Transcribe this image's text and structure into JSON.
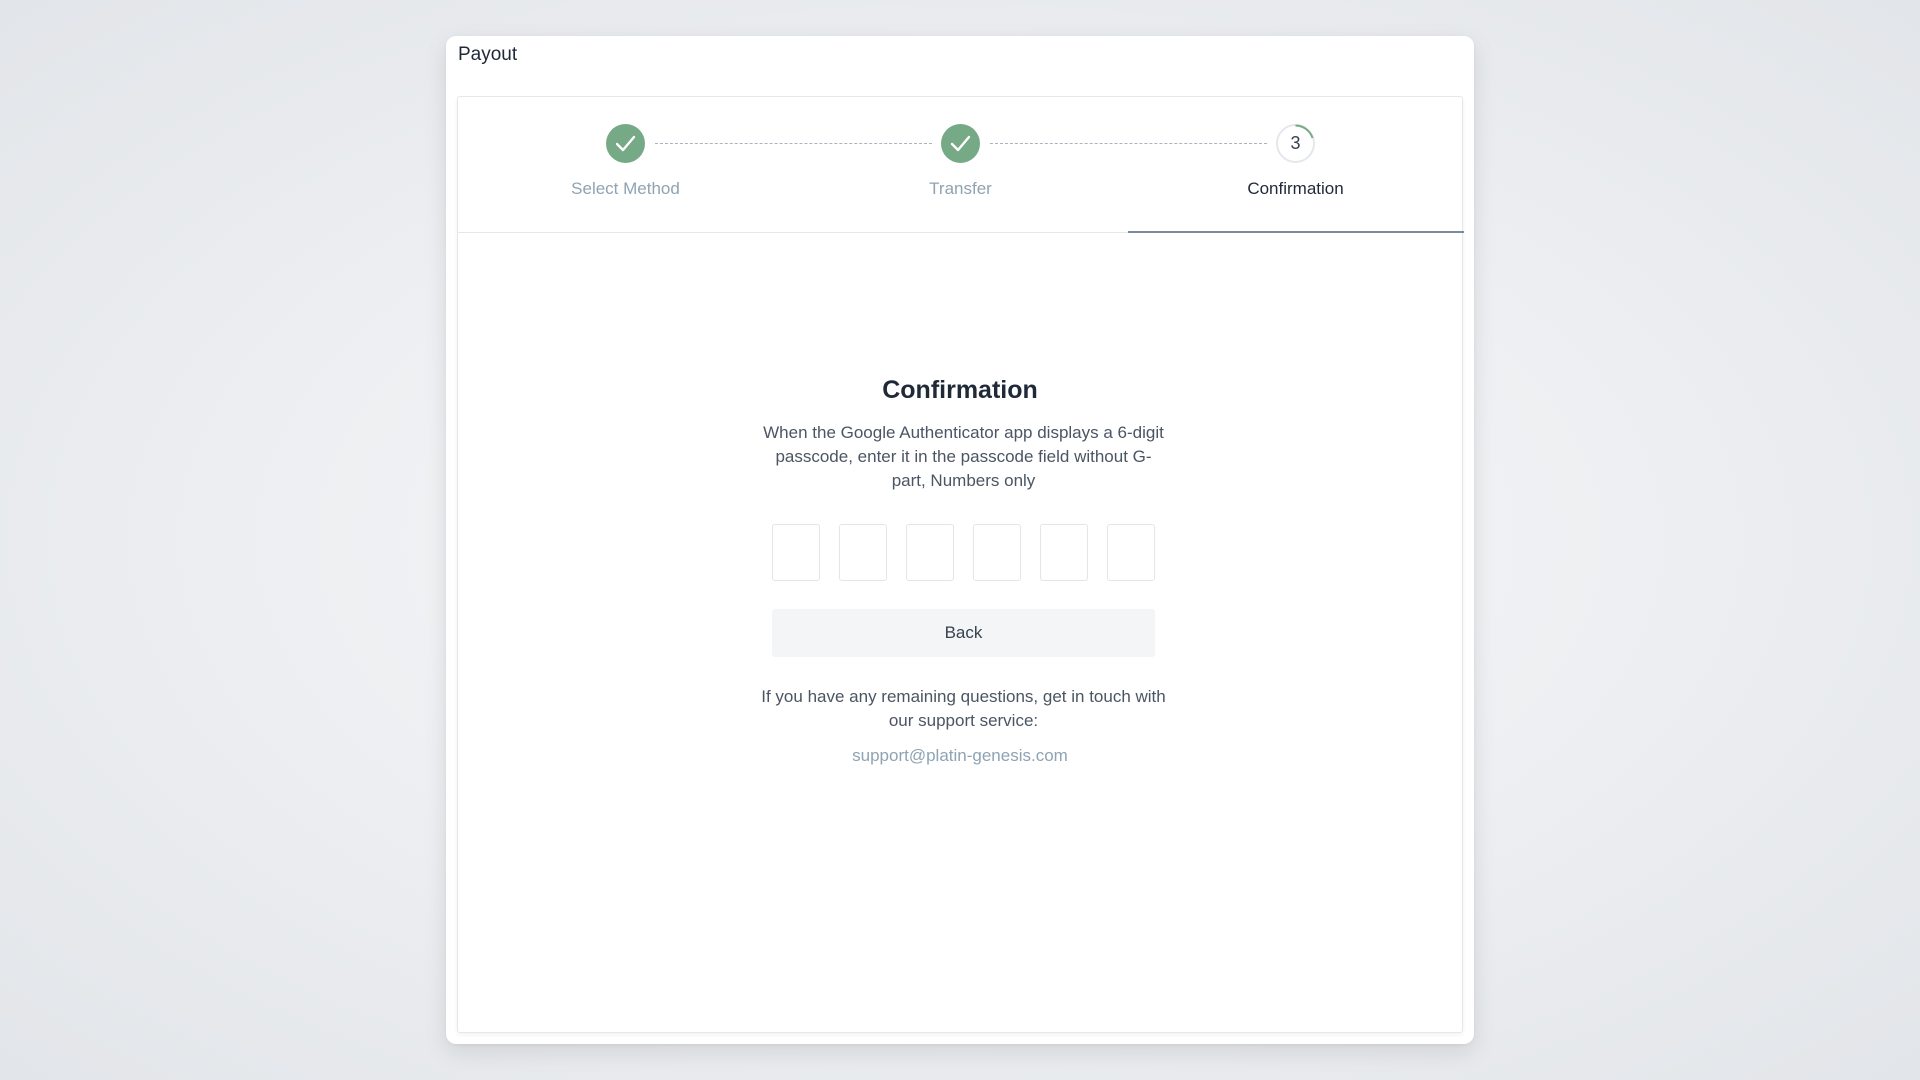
{
  "modal": {
    "title": "Payout"
  },
  "stepper": {
    "steps": [
      {
        "label": "Select Method",
        "state": "completed",
        "icon": "check-icon"
      },
      {
        "label": "Transfer",
        "state": "completed",
        "icon": "check-icon"
      },
      {
        "label": "Confirmation",
        "state": "active",
        "number": "3"
      }
    ]
  },
  "confirmation": {
    "heading": "Confirmation",
    "description": "When the Google Authenticator app displays a 6-digit passcode, enter it in the passcode field without G-part, Numbers only",
    "code_digits": [
      "",
      "",
      "",
      "",
      "",
      ""
    ],
    "back_label": "Back",
    "support_text": "If you have any remaining questions, get in touch with our support service:",
    "support_email": "support@platin-genesis.com"
  },
  "colors": {
    "accent_green": "#76a985",
    "muted_label": "#8fa3b3",
    "underline": "#7c8a99"
  }
}
